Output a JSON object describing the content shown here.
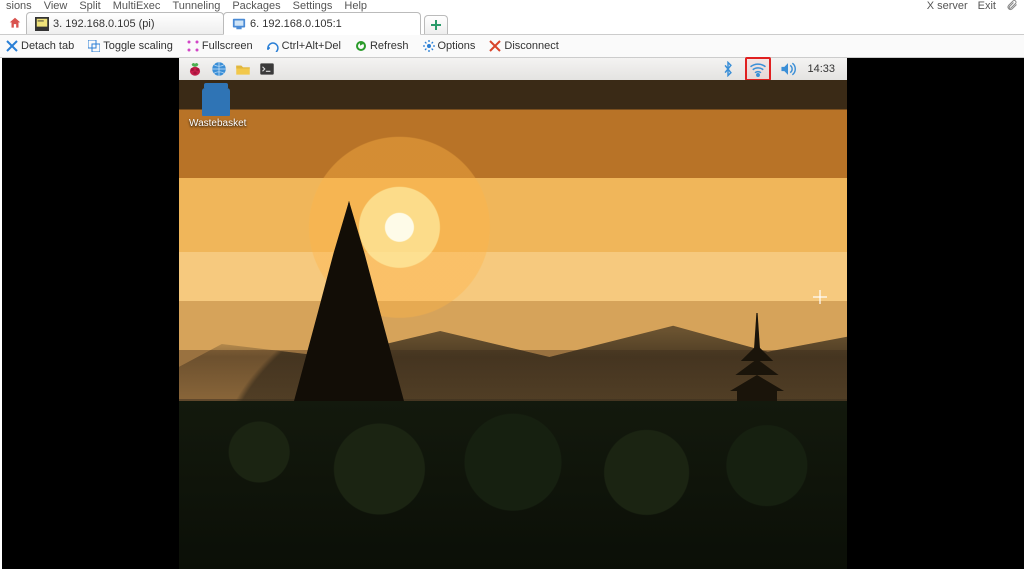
{
  "menubar": {
    "items": [
      "sions",
      "View",
      "Split",
      "MultiExec",
      "Tunneling",
      "Packages",
      "Settings",
      "Help"
    ],
    "right": [
      "X server",
      "Exit"
    ]
  },
  "tabs": [
    {
      "label": "3. 192.168.0.105 (pi)",
      "icon": "putty-icon"
    },
    {
      "label": "6. 192.168.0.105:1",
      "icon": "vnc-icon"
    }
  ],
  "toolbar": {
    "detach": "Detach tab",
    "scale": "Toggle scaling",
    "full": "Fullscreen",
    "cad": "Ctrl+Alt+Del",
    "refresh": "Refresh",
    "options": "Options",
    "disconnect": "Disconnect"
  },
  "rpi": {
    "clock": "14:33",
    "desktop_icon_label": "Wastebasket"
  }
}
